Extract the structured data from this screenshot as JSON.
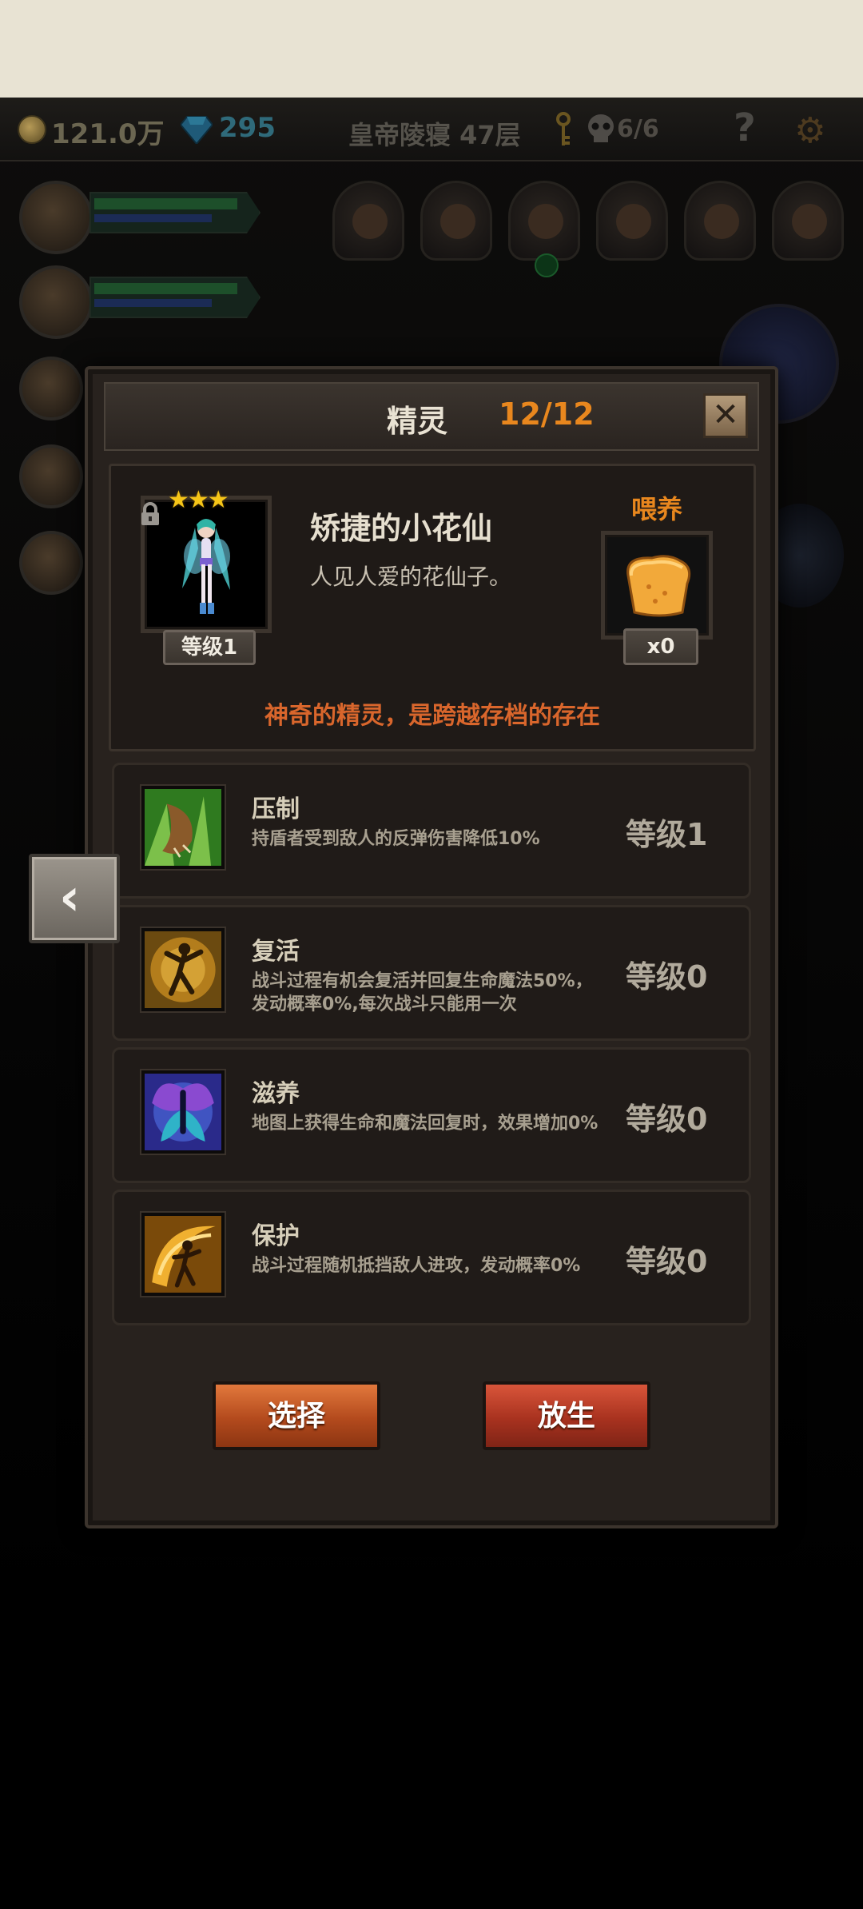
{
  "hud": {
    "gold": "121.0万",
    "gems": "295",
    "floor": "皇帝陵寝 47层",
    "keys": "6/6",
    "help": "?"
  },
  "dialog": {
    "title": "精灵",
    "count": "12/12",
    "close": "✕"
  },
  "spirit": {
    "stars": "★★★",
    "level": "等级1",
    "name": "矫捷的小花仙",
    "description": "人见人爱的花仙子。",
    "feed_label": "喂养",
    "feed_qty": "x0",
    "tagline": "神奇的精灵，是跨越存档的存在"
  },
  "skills": [
    {
      "name": "压制",
      "desc": "持盾者受到敌人的反弹伤害降低10%",
      "level": "等级1"
    },
    {
      "name": "复活",
      "desc": "战斗过程有机会复活并回复生命魔法50%，发动概率0%,每次战斗只能用一次",
      "level": "等级0"
    },
    {
      "name": "滋养",
      "desc": "地图上获得生命和魔法回复时，效果增加0%",
      "level": "等级0"
    },
    {
      "name": "保护",
      "desc": "战斗过程随机抵挡敌人进攻，发动概率0%",
      "level": "等级0"
    }
  ],
  "buttons": {
    "select": "选择",
    "release": "放生",
    "back": "‹"
  },
  "colors": {
    "accent_orange": "#e8871e",
    "tagline_red": "#d9662c",
    "select_button": "#c85a28",
    "release_button": "#b53a24"
  }
}
